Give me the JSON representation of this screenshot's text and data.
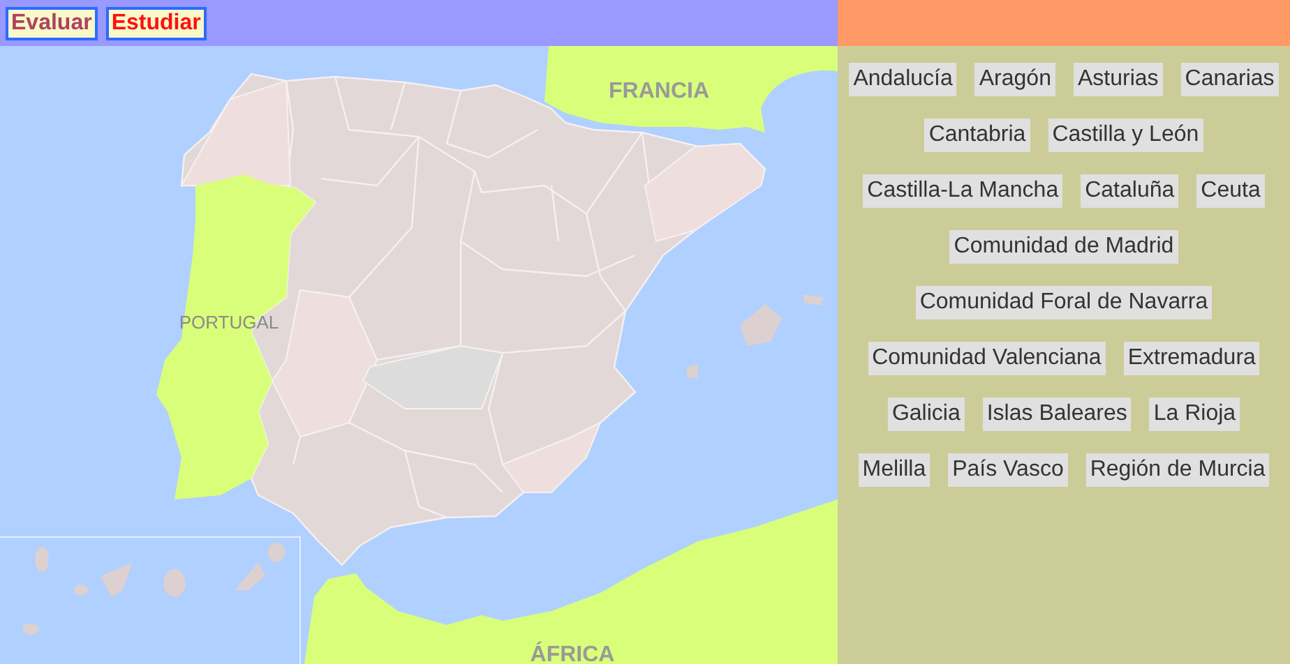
{
  "modes": [
    {
      "label": "Evaluar",
      "selected": false
    },
    {
      "label": "Estudiar",
      "selected": true
    }
  ],
  "map": {
    "countries": [
      {
        "kind": "france",
        "label": "FRANCIA"
      },
      {
        "kind": "portugal",
        "label": "PORTUGAL"
      },
      {
        "kind": "africa",
        "label": "ÁFRICA"
      }
    ]
  },
  "regions": [
    "Andalucía",
    "Aragón",
    "Asturias",
    "Canarias",
    "Cantabria",
    "Castilla y León",
    "Castilla-La Mancha",
    "Cataluña",
    "Ceuta",
    "Comunidad de Madrid",
    "Comunidad Foral de Navarra",
    "Comunidad Valenciana",
    "Extremadura",
    "Galicia",
    "Islas Baleares",
    "La Rioja",
    "Melilla",
    "País Vasco",
    "Región de Murcia"
  ]
}
